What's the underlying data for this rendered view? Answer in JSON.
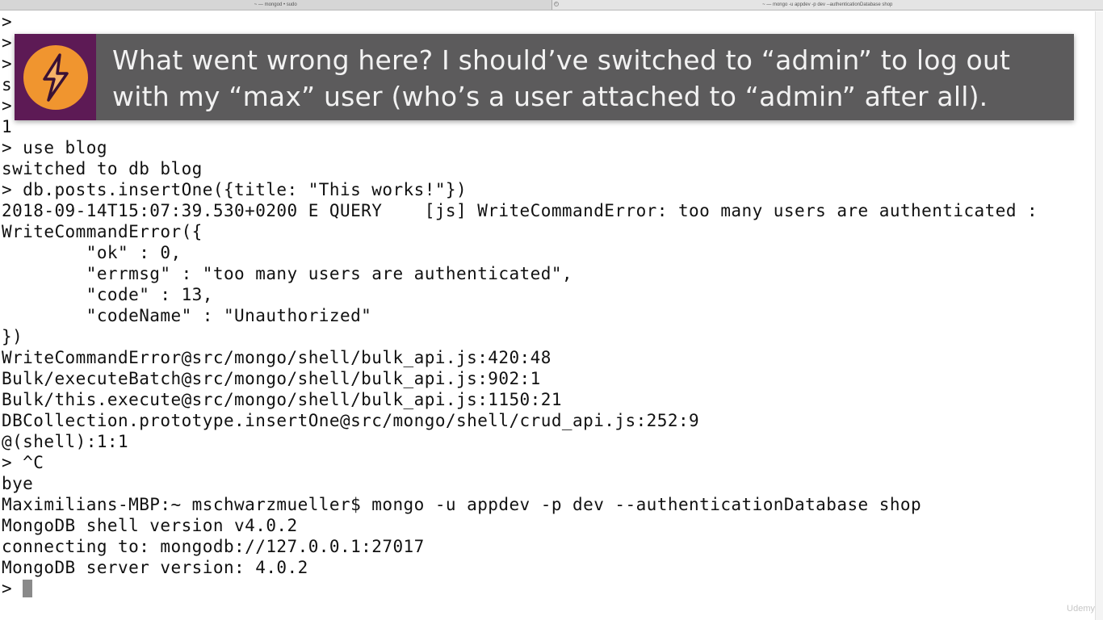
{
  "tabs": [
    {
      "title": "~ — mongod • sudo",
      "active": false
    },
    {
      "title": "~ — mongo -u appdev -p dev --authenticationDatabase shop",
      "active": true
    }
  ],
  "terminal": {
    "lines": [
      ">",
      ">",
      ">",
      "s",
      ">",
      "1",
      "> use blog",
      "switched to db blog",
      "> db.posts.insertOne({title: \"This works!\"})",
      "2018-09-14T15:07:39.530+0200 E QUERY    [js] WriteCommandError: too many users are authenticated :",
      "WriteCommandError({",
      "        \"ok\" : 0,",
      "        \"errmsg\" : \"too many users are authenticated\",",
      "        \"code\" : 13,",
      "        \"codeName\" : \"Unauthorized\"",
      "})",
      "WriteCommandError@src/mongo/shell/bulk_api.js:420:48",
      "Bulk/executeBatch@src/mongo/shell/bulk_api.js:902:1",
      "Bulk/this.execute@src/mongo/shell/bulk_api.js:1150:21",
      "DBCollection.prototype.insertOne@src/mongo/shell/crud_api.js:252:9",
      "@(shell):1:1",
      "> ^C",
      "bye",
      "Maximilians-MBP:~ mschwarzmueller$ mongo -u appdev -p dev --authenticationDatabase shop",
      "MongoDB shell version v4.0.2",
      "connecting to: mongodb://127.0.0.1:27017",
      "MongoDB server version: 4.0.2"
    ],
    "prompt": "> "
  },
  "callout": {
    "line1": "What went wrong here? I should’ve switched to “admin” to log out",
    "line2": "with my “max” user (who’s a user attached to “admin” after all).",
    "icon": "lightning-bolt-icon"
  },
  "watermark": "Udemy",
  "colors": {
    "callout_bg": "#5c5b5c",
    "badge_bg": "#5d1a55",
    "badge_circle": "#f0952f"
  }
}
